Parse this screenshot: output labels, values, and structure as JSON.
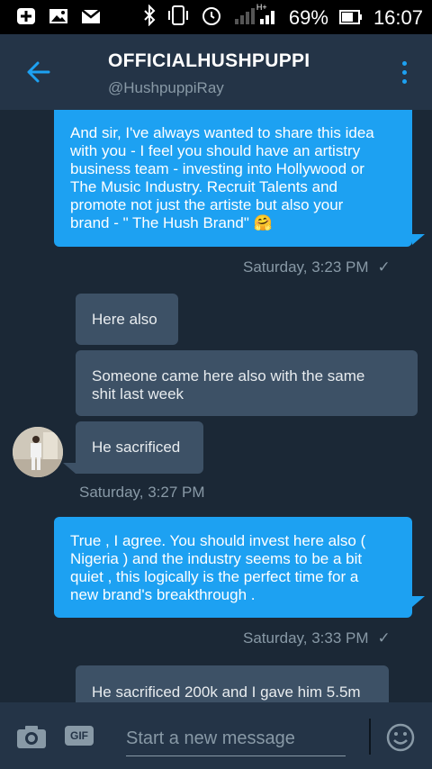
{
  "status_bar": {
    "battery_percent": "69%",
    "time": "16:07",
    "network_label": "H+",
    "icons": [
      "add-icon",
      "image-icon",
      "gmail-icon",
      "bluetooth-icon",
      "vibrate-icon",
      "alarm-icon",
      "signal-icon",
      "battery-icon"
    ]
  },
  "header": {
    "title": "OFFICIALHUSHPUPPI",
    "handle": "@HushpuppiRay",
    "accent_color": "#1da1f2"
  },
  "messages": [
    {
      "direction": "out",
      "lines": [
        "And sir, I've always wanted to share this idea",
        "with you - I feel you should have an artistry",
        "business team - investing into Hollywood or",
        "The Music Industry. Recruit Talents and",
        "promote not just the artiste but also your",
        "brand - \" The Hush Brand\" 🤗"
      ],
      "timestamp": "Saturday, 3:23 PM",
      "status": "✓"
    },
    {
      "direction": "in",
      "lines": [
        "Here also"
      ]
    },
    {
      "direction": "in",
      "lines": [
        "Someone came here also with the same",
        "shit last week"
      ]
    },
    {
      "direction": "in",
      "lines": [
        "He sacrificed"
      ],
      "timestamp": "Saturday, 3:27 PM"
    },
    {
      "direction": "out",
      "lines": [
        "True , I agree. You should invest here also (",
        "Nigeria ) and the industry seems to be a bit",
        "quiet , this logically is the perfect time for a",
        "new brand's breakthrough ."
      ],
      "timestamp": "Saturday, 3:33 PM",
      "status": "✓"
    },
    {
      "direction": "in",
      "lines": [
        "He sacrificed 200k and I gave him 5.5m"
      ]
    }
  ],
  "composer": {
    "placeholder": "Start a new message",
    "gif_label": "GIF"
  },
  "colors": {
    "background": "#1b2836",
    "header": "#243447",
    "outgoing_bubble": "#1da1f2",
    "incoming_bubble": "#3d5166",
    "secondary_text": "#8899a6"
  }
}
